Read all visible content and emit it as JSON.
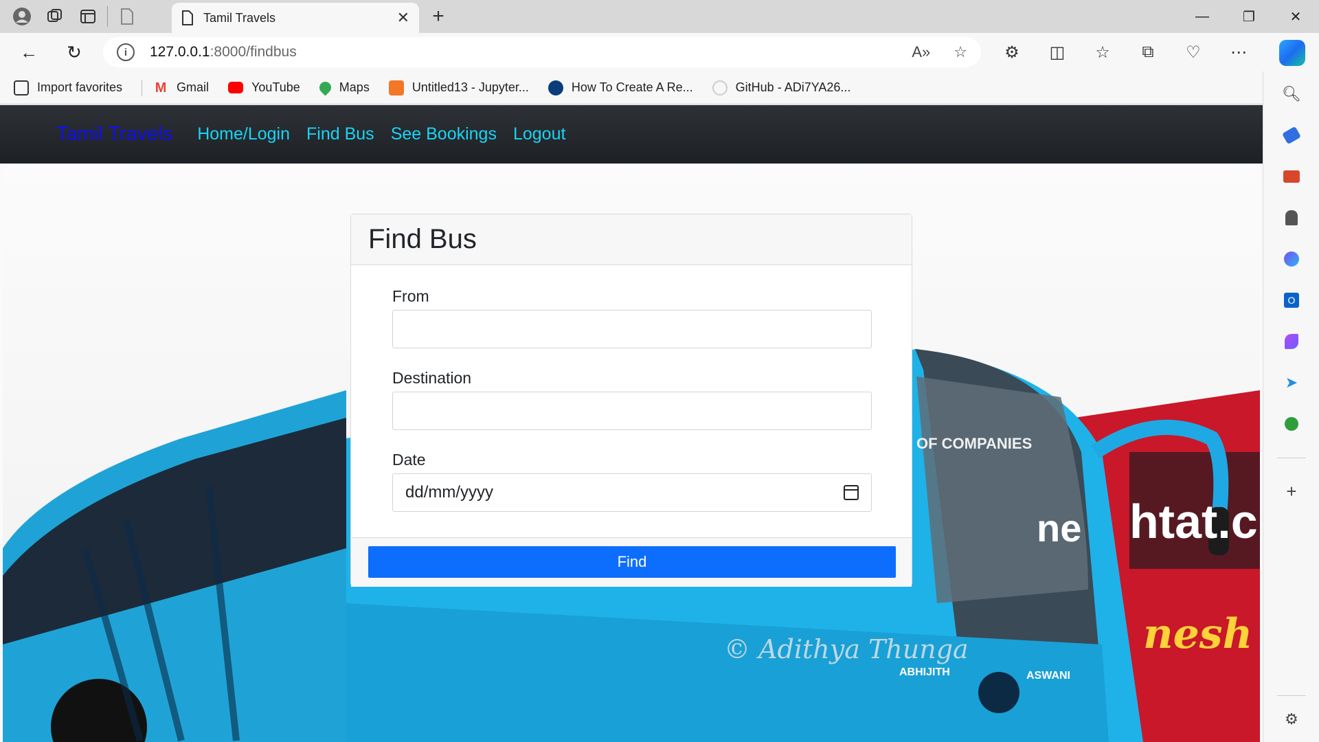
{
  "browser": {
    "tab_title": "Tamil Travels",
    "url_host": "127.0.0.1",
    "url_path": ":8000/findbus",
    "favorites": [
      {
        "label": "Import favorites",
        "icon": "import-icon",
        "color": "#333333"
      },
      {
        "label": "Gmail",
        "icon": "gmail-icon",
        "color": "#ea4335"
      },
      {
        "label": "YouTube",
        "icon": "youtube-icon",
        "color": "#ff0000"
      },
      {
        "label": "Maps",
        "icon": "maps-icon",
        "color": "#34a853"
      },
      {
        "label": "Untitled13 - Jupyter...",
        "icon": "jupyter-icon",
        "color": "#f37726"
      },
      {
        "label": "How To Create A Re...",
        "icon": "site-icon",
        "color": "#0a3d7a"
      },
      {
        "label": "GitHub - ADi7YA26...",
        "icon": "github-icon",
        "color": "#222222"
      }
    ]
  },
  "site": {
    "brand": "Tamil Travels",
    "nav": [
      "Home/Login",
      "Find Bus",
      "See Bookings",
      "Logout"
    ],
    "brand_color": "#1010f0",
    "link_color": "#19d4f5"
  },
  "form": {
    "title": "Find Bus",
    "from_label": "From",
    "from_value": "",
    "destination_label": "Destination",
    "destination_value": "",
    "date_label": "Date",
    "date_placeholder": "dd/mm/yyyy",
    "submit_label": "Find",
    "button_color": "#0d6efd"
  },
  "background_image": {
    "texts": [
      "OF COMPANIES",
      "ne",
      "htat.c",
      "nesh",
      "ABHIJITH",
      "ASWANI",
      "© Adithya Thunga"
    ]
  }
}
